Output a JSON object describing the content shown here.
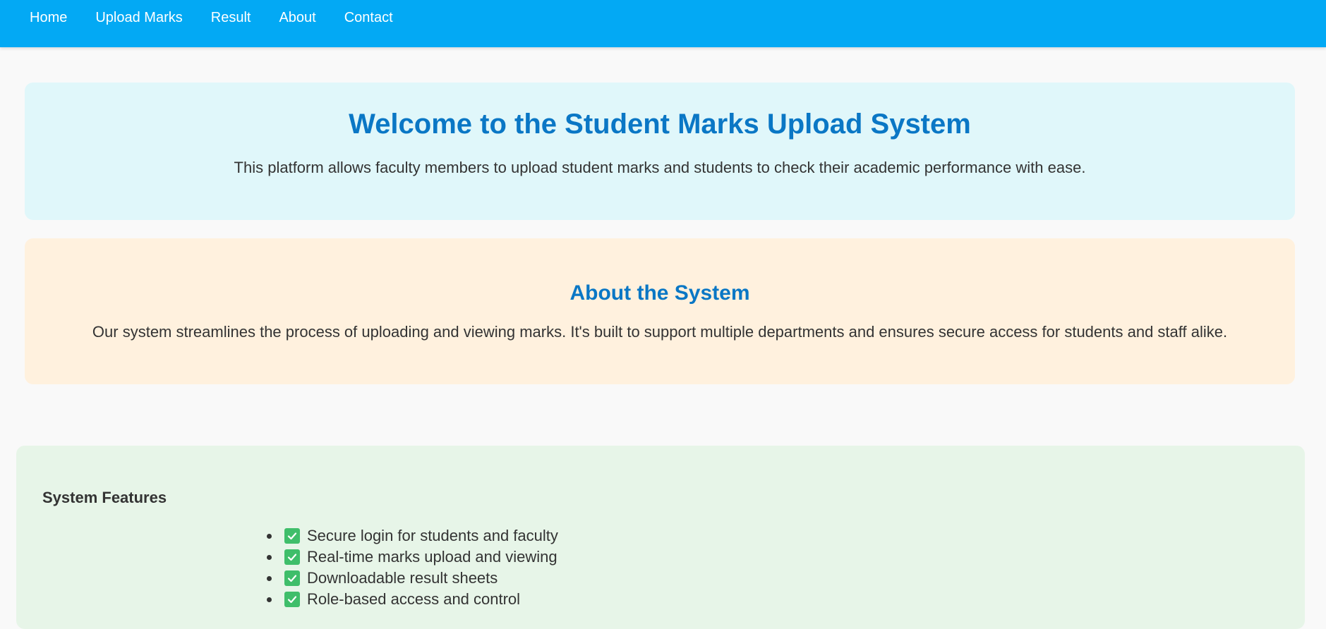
{
  "nav": {
    "items": [
      {
        "label": "Home"
      },
      {
        "label": "Upload Marks"
      },
      {
        "label": "Result"
      },
      {
        "label": "About"
      },
      {
        "label": "Contact"
      }
    ]
  },
  "hero": {
    "title": "Welcome to the Student Marks Upload System",
    "text": "This platform allows faculty members to upload student marks and students to check their academic performance with ease."
  },
  "about": {
    "title": "About the System",
    "text": "Our system streamlines the process of uploading and viewing marks. It's built to support multiple departments and ensures secure access for students and staff alike."
  },
  "features": {
    "title": "System Features",
    "icon": "check-mark-icon",
    "items": [
      {
        "label": "Secure login for students and faculty"
      },
      {
        "label": "Real-time marks upload and viewing"
      },
      {
        "label": "Downloadable result sheets"
      },
      {
        "label": "Role-based access and control"
      }
    ]
  },
  "colors": {
    "navbar": "#03a9f4",
    "hero_bg": "#e0f7fa",
    "about_bg": "#fff1de",
    "features_bg": "#e7f5e8",
    "heading": "#0a77c5",
    "check": "#3fbe6a"
  }
}
